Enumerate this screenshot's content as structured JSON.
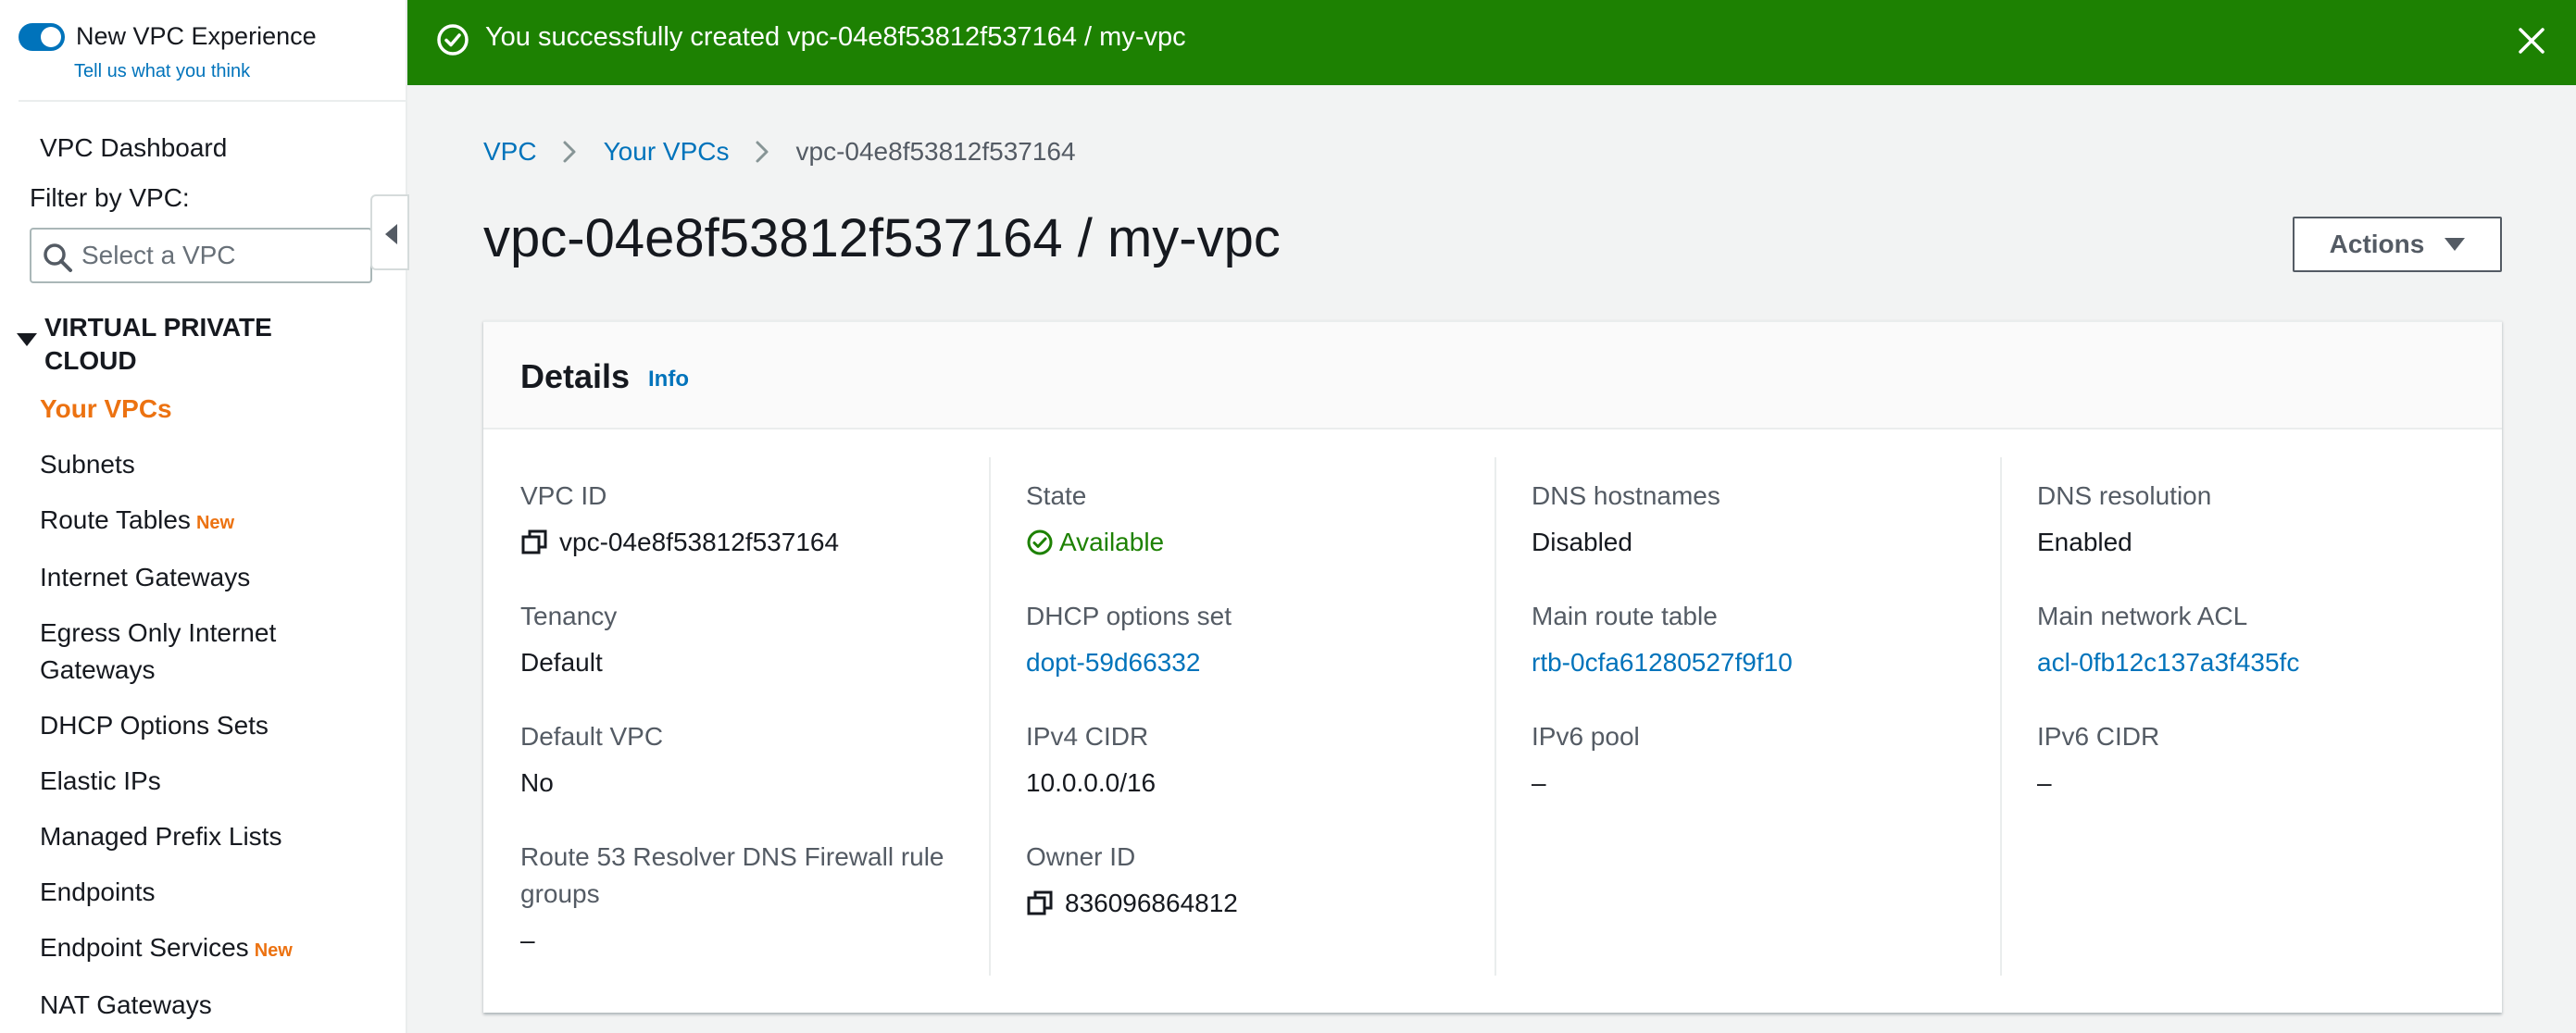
{
  "experience_toggle": {
    "label": "New VPC Experience",
    "feedback": "Tell us what you think"
  },
  "sidebar": {
    "dashboard": "VPC Dashboard",
    "filter_label": "Filter by VPC:",
    "filter_placeholder": "Select a VPC",
    "section_title": "VIRTUAL PRIVATE CLOUD",
    "new_badge": "New",
    "items": [
      {
        "label": "Your VPCs",
        "active": true,
        "badge": false
      },
      {
        "label": "Subnets",
        "active": false,
        "badge": false
      },
      {
        "label": "Route Tables",
        "active": false,
        "badge": true
      },
      {
        "label": "Internet Gateways",
        "active": false,
        "badge": false
      },
      {
        "label": "Egress Only Internet Gateways",
        "active": false,
        "badge": false
      },
      {
        "label": "DHCP Options Sets",
        "active": false,
        "badge": false
      },
      {
        "label": "Elastic IPs",
        "active": false,
        "badge": false
      },
      {
        "label": "Managed Prefix Lists",
        "active": false,
        "badge": false
      },
      {
        "label": "Endpoints",
        "active": false,
        "badge": false
      },
      {
        "label": "Endpoint Services",
        "active": false,
        "badge": true
      },
      {
        "label": "NAT Gateways",
        "active": false,
        "badge": false
      }
    ]
  },
  "banner": {
    "message": "You successfully created vpc-04e8f53812f537164 / my-vpc",
    "color": "#1d8102"
  },
  "breadcrumb": {
    "root": "VPC",
    "parent": "Your VPCs",
    "current": "vpc-04e8f53812f537164"
  },
  "page": {
    "title": "vpc-04e8f53812f537164 / my-vpc",
    "actions_label": "Actions"
  },
  "details": {
    "title": "Details",
    "info": "Info",
    "fields": {
      "vpc_id": {
        "label": "VPC ID",
        "value": "vpc-04e8f53812f537164"
      },
      "state": {
        "label": "State",
        "value": "Available"
      },
      "dns_hostnames": {
        "label": "DNS hostnames",
        "value": "Disabled"
      },
      "dns_resolution": {
        "label": "DNS resolution",
        "value": "Enabled"
      },
      "tenancy": {
        "label": "Tenancy",
        "value": "Default"
      },
      "dhcp_options": {
        "label": "DHCP options set",
        "value": "dopt-59d66332"
      },
      "main_route_table": {
        "label": "Main route table",
        "value": "rtb-0cfa61280527f9f10"
      },
      "main_network_acl": {
        "label": "Main network ACL",
        "value": "acl-0fb12c137a3f435fc"
      },
      "default_vpc": {
        "label": "Default VPC",
        "value": "No"
      },
      "ipv4_cidr": {
        "label": "IPv4 CIDR",
        "value": "10.0.0.0/16"
      },
      "ipv6_pool": {
        "label": "IPv6 pool",
        "value": "–"
      },
      "ipv6_cidr": {
        "label": "IPv6 CIDR",
        "value": "–"
      },
      "dns_firewall": {
        "label": "Route 53 Resolver DNS Firewall rule groups",
        "value": "–"
      },
      "owner_id": {
        "label": "Owner ID",
        "value": "836096864812"
      }
    }
  }
}
